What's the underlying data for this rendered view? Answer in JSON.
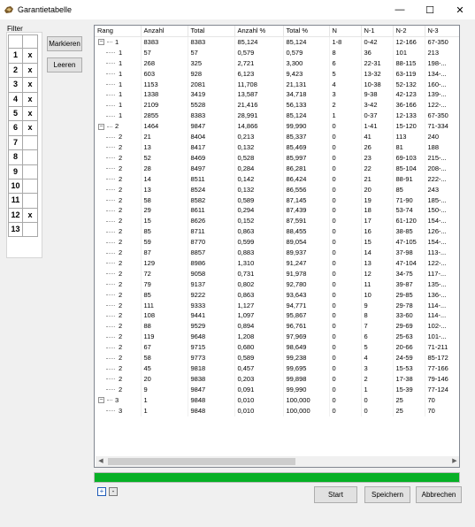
{
  "window": {
    "title": "Garantietabelle",
    "controls": [
      "—",
      "☐",
      "✕"
    ]
  },
  "filter": {
    "label": "Filter",
    "rows": [
      {
        "num": "",
        "mark": ""
      },
      {
        "num": "1",
        "mark": "x"
      },
      {
        "num": "2",
        "mark": "x"
      },
      {
        "num": "3",
        "mark": "x"
      },
      {
        "num": "4",
        "mark": "x"
      },
      {
        "num": "5",
        "mark": "x"
      },
      {
        "num": "6",
        "mark": "x"
      },
      {
        "num": "7",
        "mark": ""
      },
      {
        "num": "8",
        "mark": ""
      },
      {
        "num": "9",
        "mark": ""
      },
      {
        "num": "10",
        "mark": ""
      },
      {
        "num": "11",
        "mark": ""
      },
      {
        "num": "12",
        "mark": "x"
      },
      {
        "num": "13",
        "mark": ""
      }
    ]
  },
  "buttons": {
    "markieren": "Markieren",
    "leeren": "Leeren",
    "start": "Start",
    "speichern": "Speichern",
    "abbrechen": "Abbrechen",
    "expand_all": "+",
    "collapse_all": "-"
  },
  "table": {
    "columns": [
      "Rang",
      "Anzahl",
      "Total",
      "Anzahl %",
      "Total %",
      "N",
      "N-1",
      "N-2",
      "N-3"
    ],
    "rows": [
      {
        "level": 0,
        "expander": "−",
        "rang": "1",
        "cells": [
          "8383",
          "8383",
          "85,124",
          "85,124",
          "1-8",
          "0-42",
          "12-166",
          "67-350"
        ]
      },
      {
        "level": 1,
        "rang": "1",
        "cells": [
          "57",
          "57",
          "0,579",
          "0,579",
          "8",
          "36",
          "101",
          "213"
        ]
      },
      {
        "level": 1,
        "rang": "1",
        "cells": [
          "268",
          "325",
          "2,721",
          "3,300",
          "6",
          "22-31",
          "88-115",
          "198-..."
        ]
      },
      {
        "level": 1,
        "rang": "1",
        "cells": [
          "603",
          "928",
          "6,123",
          "9,423",
          "5",
          "13-32",
          "63-119",
          "134-..."
        ]
      },
      {
        "level": 1,
        "rang": "1",
        "cells": [
          "1153",
          "2081",
          "11,708",
          "21,131",
          "4",
          "10-38",
          "52-132",
          "160-..."
        ]
      },
      {
        "level": 1,
        "rang": "1",
        "cells": [
          "1338",
          "3419",
          "13,587",
          "34,718",
          "3",
          "9-38",
          "42-123",
          "139-..."
        ]
      },
      {
        "level": 1,
        "rang": "1",
        "cells": [
          "2109",
          "5528",
          "21,416",
          "56,133",
          "2",
          "3-42",
          "36-166",
          "122-..."
        ]
      },
      {
        "level": 1,
        "rang": "1",
        "cells": [
          "2855",
          "8383",
          "28,991",
          "85,124",
          "1",
          "0-37",
          "12-133",
          "67-350"
        ]
      },
      {
        "level": 0,
        "expander": "−",
        "rang": "2",
        "cells": [
          "1464",
          "9847",
          "14,866",
          "99,990",
          "0",
          "1-41",
          "15-120",
          "71-334"
        ]
      },
      {
        "level": 1,
        "rang": "2",
        "cells": [
          "21",
          "8404",
          "0,213",
          "85,337",
          "0",
          "41",
          "113",
          "240"
        ]
      },
      {
        "level": 1,
        "rang": "2",
        "cells": [
          "13",
          "8417",
          "0,132",
          "85,469",
          "0",
          "26",
          "81",
          "188"
        ]
      },
      {
        "level": 1,
        "rang": "2",
        "cells": [
          "52",
          "8469",
          "0,528",
          "85,997",
          "0",
          "23",
          "69-103",
          "215-..."
        ]
      },
      {
        "level": 1,
        "rang": "2",
        "cells": [
          "28",
          "8497",
          "0,284",
          "86,281",
          "0",
          "22",
          "85-104",
          "208-..."
        ]
      },
      {
        "level": 1,
        "rang": "2",
        "cells": [
          "14",
          "8511",
          "0,142",
          "86,424",
          "0",
          "21",
          "88-91",
          "222-..."
        ]
      },
      {
        "level": 1,
        "rang": "2",
        "cells": [
          "13",
          "8524",
          "0,132",
          "86,556",
          "0",
          "20",
          "85",
          "243"
        ]
      },
      {
        "level": 1,
        "rang": "2",
        "cells": [
          "58",
          "8582",
          "0,589",
          "87,145",
          "0",
          "19",
          "71-90",
          "185-..."
        ]
      },
      {
        "level": 1,
        "rang": "2",
        "cells": [
          "29",
          "8611",
          "0,294",
          "87,439",
          "0",
          "18",
          "53-74",
          "150-..."
        ]
      },
      {
        "level": 1,
        "rang": "2",
        "cells": [
          "15",
          "8626",
          "0,152",
          "87,591",
          "0",
          "17",
          "61-120",
          "154-..."
        ]
      },
      {
        "level": 1,
        "rang": "2",
        "cells": [
          "85",
          "8711",
          "0,863",
          "88,455",
          "0",
          "16",
          "38-85",
          "126-..."
        ]
      },
      {
        "level": 1,
        "rang": "2",
        "cells": [
          "59",
          "8770",
          "0,599",
          "89,054",
          "0",
          "15",
          "47-105",
          "154-..."
        ]
      },
      {
        "level": 1,
        "rang": "2",
        "cells": [
          "87",
          "8857",
          "0,883",
          "89,937",
          "0",
          "14",
          "37-98",
          "113-..."
        ]
      },
      {
        "level": 1,
        "rang": "2",
        "cells": [
          "129",
          "8986",
          "1,310",
          "91,247",
          "0",
          "13",
          "47-104",
          "122-..."
        ]
      },
      {
        "level": 1,
        "rang": "2",
        "cells": [
          "72",
          "9058",
          "0,731",
          "91,978",
          "0",
          "12",
          "34-75",
          "117-..."
        ]
      },
      {
        "level": 1,
        "rang": "2",
        "cells": [
          "79",
          "9137",
          "0,802",
          "92,780",
          "0",
          "11",
          "39-87",
          "135-..."
        ]
      },
      {
        "level": 1,
        "rang": "2",
        "cells": [
          "85",
          "9222",
          "0,863",
          "93,643",
          "0",
          "10",
          "29-85",
          "136-..."
        ]
      },
      {
        "level": 1,
        "rang": "2",
        "cells": [
          "111",
          "9333",
          "1,127",
          "94,771",
          "0",
          "9",
          "29-78",
          "114-..."
        ]
      },
      {
        "level": 1,
        "rang": "2",
        "cells": [
          "108",
          "9441",
          "1,097",
          "95,867",
          "0",
          "8",
          "33-60",
          "114-..."
        ]
      },
      {
        "level": 1,
        "rang": "2",
        "cells": [
          "88",
          "9529",
          "0,894",
          "96,761",
          "0",
          "7",
          "29-69",
          "102-..."
        ]
      },
      {
        "level": 1,
        "rang": "2",
        "cells": [
          "119",
          "9648",
          "1,208",
          "97,969",
          "0",
          "6",
          "25-63",
          "101-..."
        ]
      },
      {
        "level": 1,
        "rang": "2",
        "cells": [
          "67",
          "9715",
          "0,680",
          "98,649",
          "0",
          "5",
          "20-66",
          "71-211"
        ]
      },
      {
        "level": 1,
        "rang": "2",
        "cells": [
          "58",
          "9773",
          "0,589",
          "99,238",
          "0",
          "4",
          "24-59",
          "85-172"
        ]
      },
      {
        "level": 1,
        "rang": "2",
        "cells": [
          "45",
          "9818",
          "0,457",
          "99,695",
          "0",
          "3",
          "15-53",
          "77-166"
        ]
      },
      {
        "level": 1,
        "rang": "2",
        "cells": [
          "20",
          "9838",
          "0,203",
          "99,898",
          "0",
          "2",
          "17-38",
          "79-146"
        ]
      },
      {
        "level": 1,
        "rang": "2",
        "cells": [
          "9",
          "9847",
          "0,091",
          "99,990",
          "0",
          "1",
          "15-39",
          "77-124"
        ]
      },
      {
        "level": 0,
        "expander": "−",
        "rang": "3",
        "cells": [
          "1",
          "9848",
          "0,010",
          "100,000",
          "0",
          "0",
          "25",
          "70"
        ]
      },
      {
        "level": 1,
        "rang": "3",
        "cells": [
          "1",
          "9848",
          "0,010",
          "100,000",
          "0",
          "0",
          "25",
          "70"
        ]
      }
    ]
  },
  "progress": {
    "value_percent": 100,
    "color": "#06b025"
  }
}
